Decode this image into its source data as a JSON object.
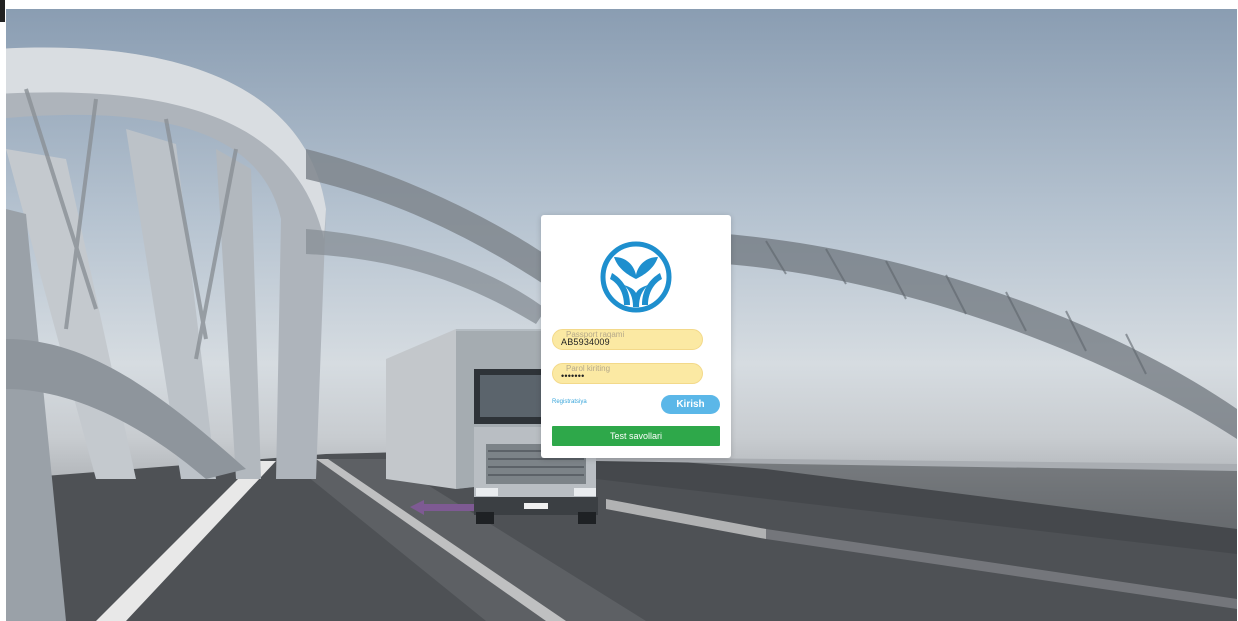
{
  "login": {
    "username_placeholder": "Passport raqami",
    "username_value": "AB5934009",
    "password_placeholder": "Parol kiriting",
    "password_value": "•••••••",
    "register_link": "Registratsiya",
    "submit_label": "Kirish",
    "tests_button": "Test savollari"
  },
  "colors": {
    "submit": "#5bb7e8",
    "tests": "#2ea84a",
    "field_bg": "#fbe9a3",
    "logo": "#1e8fce"
  },
  "icons": {
    "logo": "brand-logo-icon"
  }
}
